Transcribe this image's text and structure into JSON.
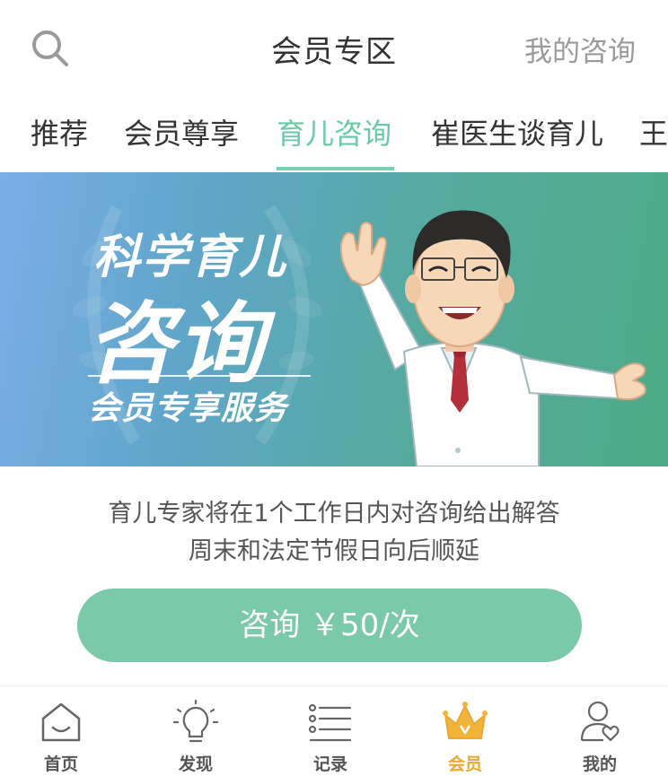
{
  "header": {
    "title": "会员专区",
    "right_link": "我的咨询",
    "search_icon": "search-icon"
  },
  "tabs": {
    "items": [
      {
        "label": "推荐"
      },
      {
        "label": "会员尊享"
      },
      {
        "label": "育儿咨询"
      },
      {
        "label": "崔医生谈育儿"
      },
      {
        "label": "王"
      }
    ],
    "active": "育儿咨询",
    "active_color": "#6cc9a6"
  },
  "banner": {
    "line1": "科学育儿",
    "line2": "咨询",
    "line3": "会员专享服务"
  },
  "info": {
    "line1": "育儿专家将在1个工作日内对咨询给出解答",
    "line2": "周末和法定节假日向后顺延"
  },
  "consult_button": {
    "label": "咨询 ￥50/次",
    "color": "#7acaaa"
  },
  "bottom_nav": {
    "items": [
      {
        "label": "首页",
        "icon": "home-icon"
      },
      {
        "label": "发现",
        "icon": "lightbulb-icon"
      },
      {
        "label": "记录",
        "icon": "list-icon"
      },
      {
        "label": "会员",
        "icon": "crown-icon"
      },
      {
        "label": "我的",
        "icon": "user-icon"
      }
    ],
    "active": "会员",
    "active_color": "#e9a82f"
  }
}
